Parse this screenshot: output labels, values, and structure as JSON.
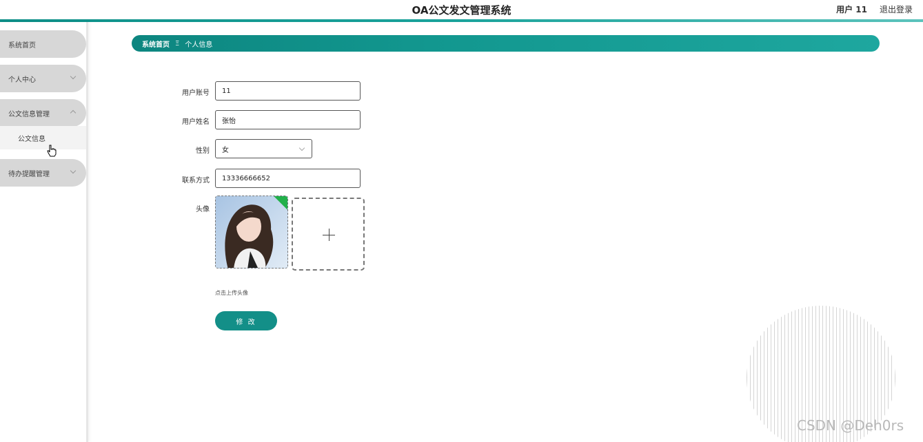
{
  "header": {
    "title": "OA公文发文管理系统",
    "user_label": "用户 11",
    "logout_label": "退出登录"
  },
  "sidebar": {
    "items": [
      {
        "label": "系统首页"
      },
      {
        "label": "个人中心"
      },
      {
        "label": "公文信息管理"
      },
      {
        "label": "待办提醒管理"
      }
    ],
    "submenu": {
      "label": "公文信息"
    }
  },
  "breadcrumb": {
    "home": "系统首页",
    "separator": "Ξ",
    "current": "个人信息"
  },
  "form": {
    "account": {
      "label": "用户账号",
      "value": "11"
    },
    "name": {
      "label": "用户姓名",
      "value": "张怡"
    },
    "gender": {
      "label": "性别",
      "value": "女"
    },
    "phone": {
      "label": "联系方式",
      "value": "13336666652"
    },
    "avatar": {
      "label": "头像"
    },
    "upload_hint": "点击上传头像",
    "submit_label": "修 改"
  },
  "watermark": "CSDN @Deh0rs",
  "colors": {
    "accent": "#138f88",
    "menu_pill": "#d7d7d7"
  }
}
